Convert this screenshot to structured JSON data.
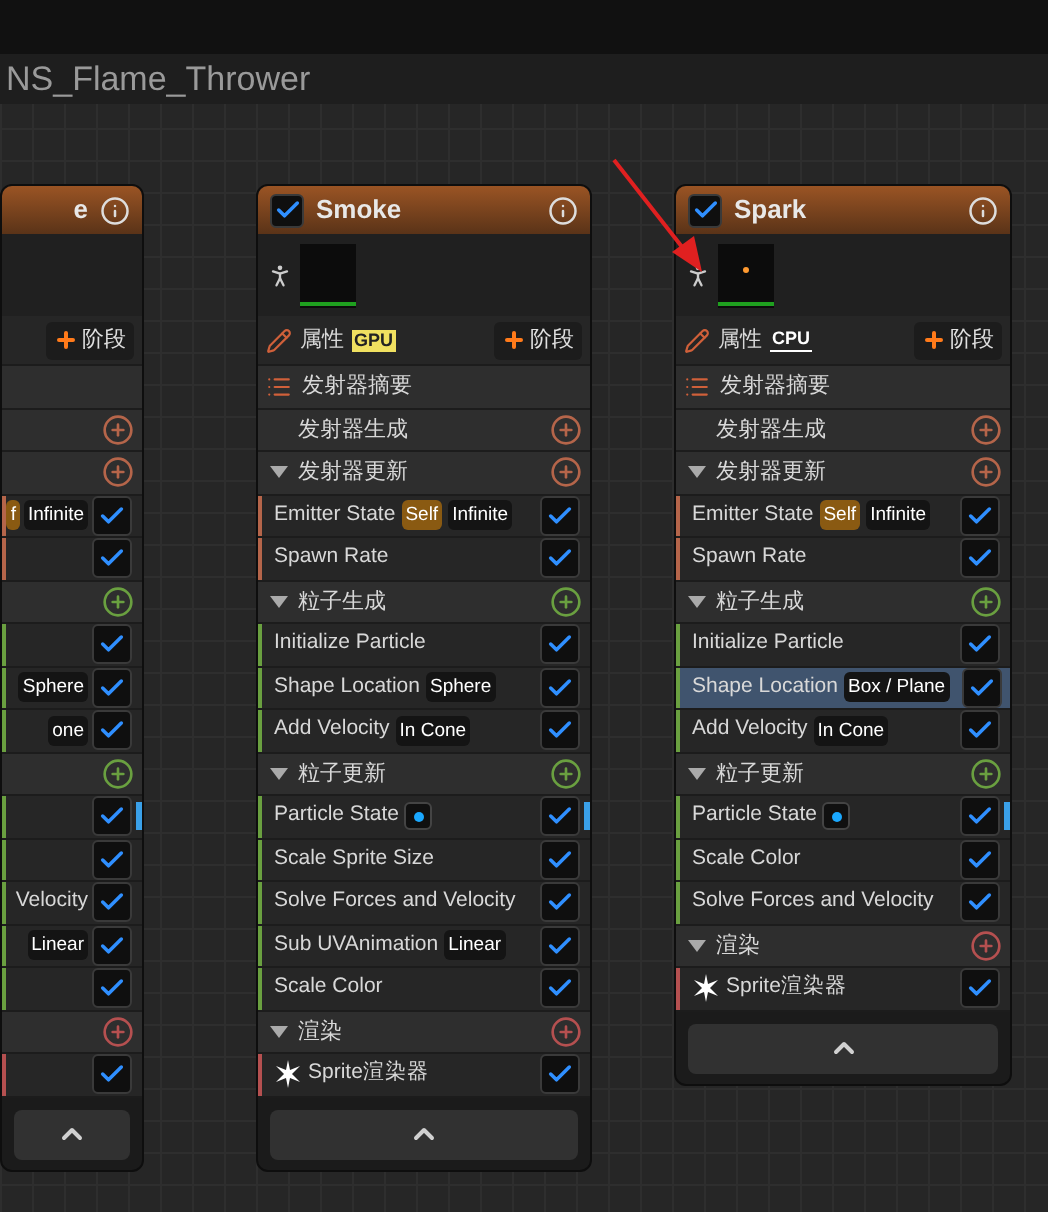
{
  "header": {
    "title": "NS_Flame_Thrower"
  },
  "nodes": [
    {
      "kind": "partial",
      "title": "e",
      "stage_button": "阶段",
      "groups": [
        {
          "color": "#b5654a"
        },
        {
          "color": "#b5654a",
          "children": [
            {
              "kind": "module",
              "checked": true,
              "selected": false,
              "badges": [
                {
                  "kind": "self",
                  "text": "f"
                },
                {
                  "kind": "plain",
                  "text": "Infinite"
                }
              ]
            },
            {
              "kind": "module",
              "checked": true,
              "selected": false
            }
          ]
        },
        {
          "color": "#6aa040",
          "children": [
            {
              "kind": "module",
              "checked": true,
              "selected": false
            },
            {
              "kind": "module",
              "checked": true,
              "selected": false,
              "badges": [
                {
                  "kind": "plain",
                  "text": "Sphere"
                }
              ]
            },
            {
              "kind": "module",
              "checked": true,
              "selected": false,
              "badges": [
                {
                  "kind": "plain",
                  "text": "one"
                }
              ]
            }
          ]
        },
        {
          "color": "#6aa040",
          "children": [
            {
              "kind": "module",
              "checked": true,
              "selected": false,
              "flagged": true
            },
            {
              "kind": "module",
              "checked": true,
              "selected": false
            },
            {
              "kind": "module",
              "label": "Velocity",
              "checked": true,
              "selected": false
            },
            {
              "kind": "module",
              "checked": true,
              "selected": false,
              "badges": [
                {
                  "kind": "plain",
                  "text": "Linear"
                }
              ]
            },
            {
              "kind": "module",
              "checked": true,
              "selected": false
            }
          ]
        },
        {
          "color": "#b55050",
          "children": [
            {
              "kind": "module",
              "checked": true,
              "selected": false
            }
          ]
        }
      ]
    },
    {
      "kind": "full",
      "title": "Smoke",
      "enabled": true,
      "preview": {
        "particle": false
      },
      "properties": "属性",
      "sim": {
        "label": "GPU",
        "highlighted": true
      },
      "stage_button": "阶段",
      "summary": "发射器摘要",
      "groups": [
        {
          "label": "发射器生成",
          "expanded": false,
          "color": "#b5654a"
        },
        {
          "label": "发射器更新",
          "expanded": true,
          "color": "#b5654a",
          "children": [
            {
              "kind": "module",
              "label": "Emitter State",
              "checked": true,
              "selected": false,
              "badges": [
                {
                  "kind": "self",
                  "text": "Self"
                },
                {
                  "kind": "plain",
                  "text": "Infinite"
                }
              ]
            },
            {
              "kind": "module",
              "label": "Spawn Rate",
              "checked": true,
              "selected": false
            }
          ]
        },
        {
          "label": "粒子生成",
          "expanded": true,
          "color": "#6aa040",
          "children": [
            {
              "kind": "module",
              "label": "Initialize Particle",
              "checked": true,
              "selected": false
            },
            {
              "kind": "module",
              "label": "Shape Location",
              "checked": true,
              "selected": false,
              "badges": [
                {
                  "kind": "plain",
                  "text": "Sphere"
                }
              ]
            },
            {
              "kind": "module",
              "label": "Add Velocity",
              "checked": true,
              "selected": false,
              "badges": [
                {
                  "kind": "plain",
                  "text": "In Cone"
                }
              ]
            }
          ]
        },
        {
          "label": "粒子更新",
          "expanded": true,
          "color": "#6aa040",
          "children": [
            {
              "kind": "module",
              "label": "Particle State",
              "checked": true,
              "selected": false,
              "flagged": true,
              "badges": [
                {
                  "kind": "dot"
                }
              ]
            },
            {
              "kind": "module",
              "label": "Scale Sprite Size",
              "checked": true,
              "selected": false
            },
            {
              "kind": "module",
              "label": "Solve Forces and Velocity",
              "checked": true,
              "selected": false
            },
            {
              "kind": "module",
              "label": "Sub UVAnimation",
              "checked": true,
              "selected": false,
              "badges": [
                {
                  "kind": "plain",
                  "text": "Linear"
                }
              ]
            },
            {
              "kind": "module",
              "label": "Scale Color",
              "checked": true,
              "selected": false
            }
          ]
        },
        {
          "label": "渲染",
          "expanded": true,
          "color": "#b55050",
          "children": [
            {
              "kind": "renderer",
              "label": "Sprite渲染器",
              "checked": true,
              "selected": false
            }
          ]
        }
      ]
    },
    {
      "kind": "full",
      "title": "Spark",
      "enabled": true,
      "preview": {
        "particle": true
      },
      "properties": "属性",
      "sim": {
        "label": "CPU",
        "highlighted": false
      },
      "stage_button": "阶段",
      "summary": "发射器摘要",
      "groups": [
        {
          "label": "发射器生成",
          "expanded": false,
          "color": "#b5654a"
        },
        {
          "label": "发射器更新",
          "expanded": true,
          "color": "#b5654a",
          "children": [
            {
              "kind": "module",
              "label": "Emitter State",
              "checked": true,
              "selected": false,
              "badges": [
                {
                  "kind": "self",
                  "text": "Self"
                },
                {
                  "kind": "plain",
                  "text": "Infinite"
                }
              ]
            },
            {
              "kind": "module",
              "label": "Spawn Rate",
              "checked": true,
              "selected": false
            }
          ]
        },
        {
          "label": "粒子生成",
          "expanded": true,
          "color": "#6aa040",
          "children": [
            {
              "kind": "module",
              "label": "Initialize Particle",
              "checked": true,
              "selected": false
            },
            {
              "kind": "module",
              "label": "Shape Location",
              "checked": true,
              "selected": true,
              "badges": [
                {
                  "kind": "plain",
                  "text": "Box / Plane"
                }
              ]
            },
            {
              "kind": "module",
              "label": "Add Velocity",
              "checked": true,
              "selected": false,
              "badges": [
                {
                  "kind": "plain",
                  "text": "In Cone"
                }
              ]
            }
          ]
        },
        {
          "label": "粒子更新",
          "expanded": true,
          "color": "#6aa040",
          "children": [
            {
              "kind": "module",
              "label": "Particle State",
              "checked": true,
              "selected": false,
              "flagged": true,
              "badges": [
                {
                  "kind": "dot"
                }
              ]
            },
            {
              "kind": "module",
              "label": "Scale Color",
              "checked": true,
              "selected": false
            },
            {
              "kind": "module",
              "label": "Solve Forces and Velocity",
              "checked": true,
              "selected": false
            }
          ]
        },
        {
          "label": "渲染",
          "expanded": true,
          "color": "#b55050",
          "children": [
            {
              "kind": "renderer",
              "label": "Sprite渲染器",
              "checked": true,
              "selected": false
            }
          ]
        }
      ]
    }
  ]
}
